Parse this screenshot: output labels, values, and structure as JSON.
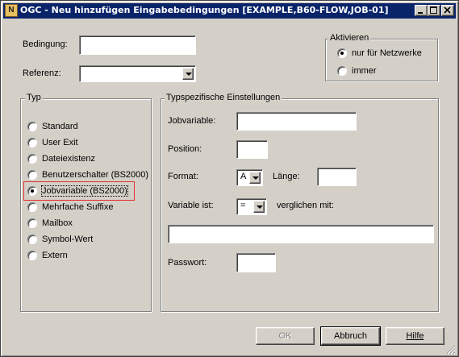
{
  "window": {
    "app_icon_letter": "N",
    "title": "OGC - Neu hinzufügen Eingabebedingungen [EXAMPLE,B60-FLOW,JOB-01]"
  },
  "form": {
    "condition_label": "Bedingung:",
    "condition_value": "",
    "reference_label": "Referenz:",
    "reference_value": ""
  },
  "activate": {
    "legend": "Aktivieren",
    "options": [
      {
        "label": "nur für Netzwerke",
        "selected": true
      },
      {
        "label": "immer",
        "selected": false
      }
    ]
  },
  "typ": {
    "legend": "Typ",
    "options": [
      {
        "label": "Standard",
        "selected": false
      },
      {
        "label": "User Exit",
        "selected": false
      },
      {
        "label": "Dateiexistenz",
        "selected": false
      },
      {
        "label": "Benutzerschalter (BS2000)",
        "selected": false
      },
      {
        "label": "Jobvariable (BS2000)",
        "selected": true
      },
      {
        "label": "Mehrfache Suffixe",
        "selected": false
      },
      {
        "label": "Mailbox",
        "selected": false
      },
      {
        "label": "Symbol-Wert",
        "selected": false
      },
      {
        "label": "Extern",
        "selected": false
      }
    ]
  },
  "specific": {
    "legend": "Typspezifische Einstellungen",
    "jobvariable_label": "Jobvariable:",
    "jobvariable_value": "",
    "position_label": "Position:",
    "position_value": "",
    "format_label": "Format:",
    "format_value": "A",
    "length_label": "Länge:",
    "length_value": "",
    "variable_label": "Variable ist:",
    "operator_value": "=",
    "compared_label": "verglichen mit:",
    "compare_value": "",
    "password_label": "Passwort:",
    "password_value": ""
  },
  "buttons": {
    "ok": "OK",
    "cancel": "Abbruch",
    "help": "Hilfe"
  },
  "colors": {
    "titlebar": "#0a246a",
    "dialog_bg": "#d4d0c8",
    "highlight": "#e03030"
  }
}
